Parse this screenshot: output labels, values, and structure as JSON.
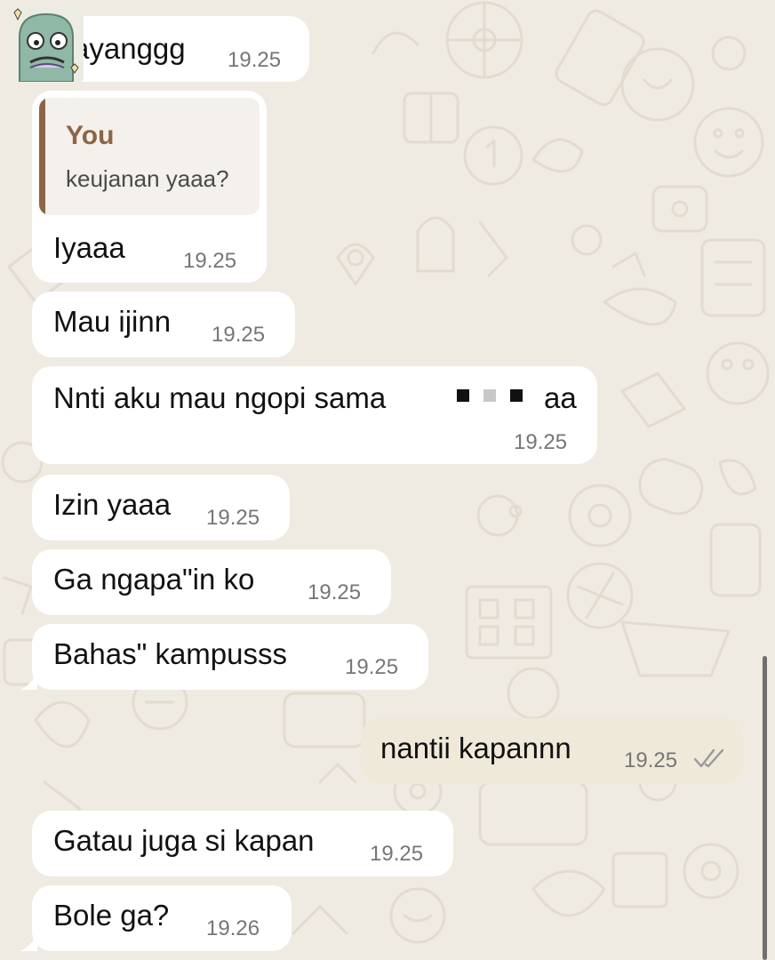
{
  "theme": {
    "wallpaper": "#f0ebe2",
    "incoming_bubble": "#ffffff",
    "outgoing_bubble": "#efe9d9",
    "quote_accent": "#8b6646",
    "timestamp": "#767676",
    "read_ticks": "#9a9a9a"
  },
  "sender": {
    "avatar_icon": "cartoon-sticker-avatar-icon"
  },
  "messages": [
    {
      "dir": "in",
      "text": "Sayanggg",
      "time": "19.25"
    },
    {
      "dir": "in",
      "quote": {
        "author": "You",
        "text": "keujanan yaaa?"
      },
      "text": "Iyaaa",
      "time": "19.25"
    },
    {
      "dir": "in",
      "text": "Mau ijinn",
      "time": "19.25"
    },
    {
      "dir": "in",
      "text": "Nnti aku mau ngopi sama",
      "text_end": "aa",
      "redacted": true,
      "time": "19.25"
    },
    {
      "dir": "in",
      "text": "Izin yaaa",
      "time": "19.25"
    },
    {
      "dir": "in",
      "text": "Ga ngapa\"in ko",
      "time": "19.25"
    },
    {
      "dir": "in",
      "text": "Bahas\" kampusss",
      "time": "19.25"
    },
    {
      "dir": "out",
      "text": "nantii kapannn",
      "time": "19.25",
      "status_icon": "double-check-icon"
    },
    {
      "dir": "in",
      "text": "Gatau juga si kapan",
      "time": "19.25"
    },
    {
      "dir": "in",
      "text": "Bole ga?",
      "time": "19.26"
    }
  ]
}
